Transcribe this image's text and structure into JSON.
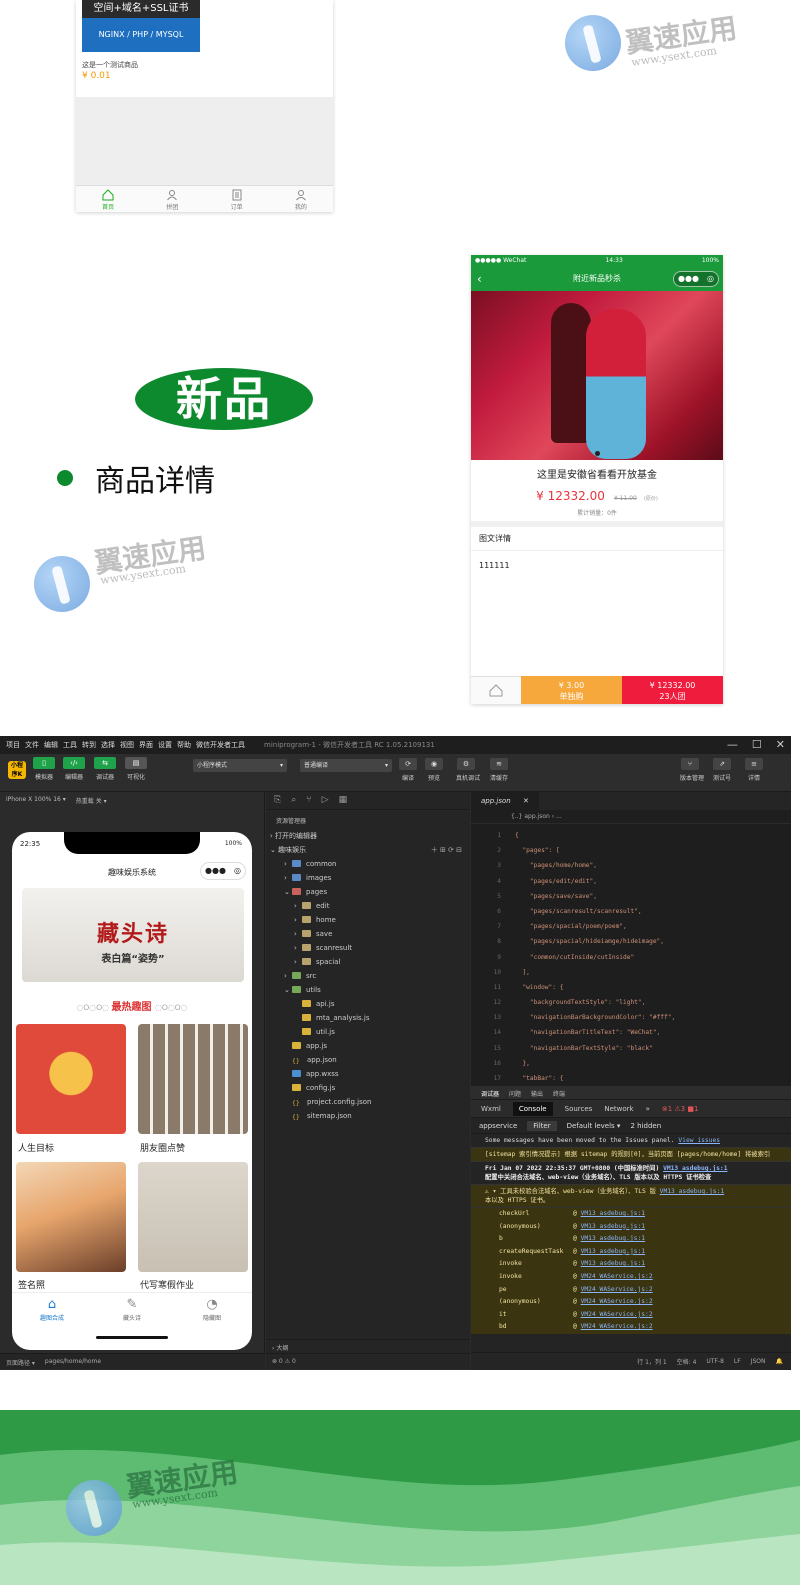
{
  "phone1": {
    "banner_top": "空间+域名+SSL证书",
    "banner_bottom": "NGINX / PHP / MYSQL",
    "product_name": "这是一个测试商品",
    "product_price": "¥ 0.01",
    "tabs": [
      "首页",
      "拼团",
      "订单",
      "我的"
    ]
  },
  "watermark": {
    "title": "翼速应用",
    "url": "www.ysext.com"
  },
  "new_product": {
    "badge": "新品",
    "bullet_text": "商品详情"
  },
  "phone2": {
    "status_left": "●●●●● WeChat",
    "status_time": "14:33",
    "status_right": "100%",
    "nav_title": "附近新品秒杀",
    "capsule_dots": "●●●",
    "product_title": "这里是安徽省看看开放基金",
    "price": "¥ 12332.00",
    "old_price": "¥ 11.00",
    "old_note": "(原价)",
    "sold": "累计销量：0件",
    "detail_header": "图文详情",
    "detail_body": "111111",
    "buy_single_price": "¥ 3.00",
    "buy_single_label": "单独购",
    "buy_group_price": "¥ 12332.00",
    "buy_group_label": "23人团"
  },
  "ide": {
    "menus": [
      "项目",
      "文件",
      "编辑",
      "工具",
      "转到",
      "选择",
      "视图",
      "界面",
      "设置",
      "帮助",
      "微信开发者工具"
    ],
    "window_title": "miniprogram-1 - 微信开发者工具 RC 1.05.2109131",
    "toolbar_left": [
      "模拟器",
      "编辑器",
      "调试器",
      "可视化"
    ],
    "mode_select": "小程序模式",
    "compile_select": "普通编译",
    "toolbar_mid": [
      "编译",
      "预览",
      "真机调试",
      "清缓存"
    ],
    "toolbar_right": [
      "版本管理",
      "测试号",
      "详情"
    ],
    "device": "iPhone X 100% 16 ▾",
    "hotreload": "热重载 关 ▾",
    "explorer": {
      "title": "资源管理器",
      "open_editors": "打开的编辑器",
      "project": "趣味娱乐",
      "tree": [
        {
          "name": "common",
          "indent": 1,
          "type": "folder-blue",
          "arrow": "›"
        },
        {
          "name": "images",
          "indent": 1,
          "type": "folder-blue",
          "arrow": "›"
        },
        {
          "name": "pages",
          "indent": 1,
          "type": "folder-red",
          "arrow": "⌄"
        },
        {
          "name": "edit",
          "indent": 2,
          "type": "folder",
          "arrow": "›"
        },
        {
          "name": "home",
          "indent": 2,
          "type": "folder",
          "arrow": "›"
        },
        {
          "name": "save",
          "indent": 2,
          "type": "folder",
          "arrow": "›"
        },
        {
          "name": "scanresult",
          "indent": 2,
          "type": "folder",
          "arrow": "›"
        },
        {
          "name": "spacial",
          "indent": 2,
          "type": "folder",
          "arrow": "›"
        },
        {
          "name": "src",
          "indent": 1,
          "type": "folder-green",
          "arrow": "›"
        },
        {
          "name": "utils",
          "indent": 1,
          "type": "folder-green",
          "arrow": "⌄"
        },
        {
          "name": "api.js",
          "indent": 2,
          "type": "js",
          "arrow": ""
        },
        {
          "name": "mta_analysis.js",
          "indent": 2,
          "type": "js",
          "arrow": ""
        },
        {
          "name": "util.js",
          "indent": 2,
          "type": "js",
          "arrow": ""
        },
        {
          "name": "app.js",
          "indent": 1,
          "type": "js",
          "arrow": ""
        },
        {
          "name": "app.json",
          "indent": 1,
          "type": "json",
          "arrow": ""
        },
        {
          "name": "app.wxss",
          "indent": 1,
          "type": "wxss",
          "arrow": ""
        },
        {
          "name": "config.js",
          "indent": 1,
          "type": "js",
          "arrow": ""
        },
        {
          "name": "project.config.json",
          "indent": 1,
          "type": "json",
          "arrow": ""
        },
        {
          "name": "sitemap.json",
          "indent": 1,
          "type": "json",
          "arrow": ""
        }
      ],
      "outline": "大纲",
      "footer": "⊗ 0 ⚠ 0"
    },
    "editor": {
      "tab": "app.json",
      "breadcrumb": "{..} app.json › ...",
      "lines": [
        {
          "n": "1",
          "t": "{"
        },
        {
          "n": "2",
          "t": "  \"pages\": ["
        },
        {
          "n": "3",
          "t": "    \"pages/home/home\","
        },
        {
          "n": "4",
          "t": "    \"pages/edit/edit\","
        },
        {
          "n": "5",
          "t": "    \"pages/save/save\","
        },
        {
          "n": "6",
          "t": "    \"pages/scanresult/scanresult\","
        },
        {
          "n": "7",
          "t": "    \"pages/spacial/poem/poem\","
        },
        {
          "n": "8",
          "t": "    \"pages/spacial/hideiamge/hideimage\","
        },
        {
          "n": "9",
          "t": "    \"common/cutInside/cutInside\""
        },
        {
          "n": "10",
          "t": "  ],"
        },
        {
          "n": "11",
          "t": "  \"window\": {"
        },
        {
          "n": "12",
          "t": "    \"backgroundTextStyle\": \"light\","
        },
        {
          "n": "13",
          "t": "    \"navigationBarBackgroundColor\": \"#fff\","
        },
        {
          "n": "14",
          "t": "    \"navigationBarTitleText\": \"WeChat\","
        },
        {
          "n": "15",
          "t": "    \"navigationBarTextStyle\": \"black\""
        },
        {
          "n": "16",
          "t": "  },"
        },
        {
          "n": "17",
          "t": "  \"tabBar\": {"
        }
      ]
    },
    "console": {
      "panel_tabs": [
        "调试器",
        "问题",
        "输出",
        "终端"
      ],
      "sub_tabs": [
        "Wxml",
        "Console",
        "Sources",
        "Network",
        "»"
      ],
      "counts": "⊗1 ⚠3 ■1",
      "context": "appservice",
      "filter": "Filter",
      "levels": "Default levels ▾",
      "hidden": "2 hidden",
      "msg1": "Some messages have been moved to the Issues panel.",
      "msg1_link": "View issues",
      "msg2": "[sitemap 索引情况提示] 根据 sitemap 的规则[0]，当前页面 [pages/home/home] 将被索引",
      "msg3": "Fri Jan 07 2022 22:35:37 GMT+0800 (中国标准时间)",
      "msg3_link": "VM13 asdebug.js:1",
      "msg3_b": "配置中关闭合法域名、web-view（业务域名）、TLS 版本以及 HTTPS 证书检查",
      "msg4": "▾ 工具未校验合法域名、web-view（业务域名）、TLS 版",
      "msg4_link": "VM13 asdebug.js:1",
      "msg4_b": "本以及 HTTPS 证书。",
      "stack": [
        {
          "fn": "checkUrl",
          "src": "VM13 asdebug.js:1"
        },
        {
          "fn": "(anonymous)",
          "src": "VM13 asdebug.js:1"
        },
        {
          "fn": "b",
          "src": "VM13 asdebug.js:1"
        },
        {
          "fn": "createRequestTask",
          "src": "VM13 asdebug.js:1"
        },
        {
          "fn": "invoke",
          "src": "VM13 asdebug.js:1"
        },
        {
          "fn": "invoke",
          "src": "VM24 WAService.js:2"
        },
        {
          "fn": "pe",
          "src": "VM24 WAService.js:2"
        },
        {
          "fn": "(anonymous)",
          "src": "VM24 WAService.js:2"
        },
        {
          "fn": "it",
          "src": "VM24 WAService.js:2"
        },
        {
          "fn": "bd",
          "src": "VM24 WAService.js:2"
        }
      ]
    },
    "status": [
      "行 1，列 1",
      "空格: 4",
      "UTF-8",
      "LF",
      "JSON"
    ],
    "sim_footer": [
      "页面路径 ▾",
      "pages/home/home"
    ],
    "sim_phone": {
      "time": "22:35",
      "battery": "100%",
      "title": "趣味娱乐系统",
      "banner_title": "藏头诗",
      "banner_sub": "表白篇“姿势”",
      "section": "最热趣图",
      "section_deco": "◌୦◌୦◌ ",
      "cards": [
        "人生目标",
        "朋友圈点赞",
        "签名照",
        "代写寒假作业"
      ],
      "tabs": [
        "趣图合成",
        "藏头诗",
        "隐藏图"
      ]
    }
  }
}
